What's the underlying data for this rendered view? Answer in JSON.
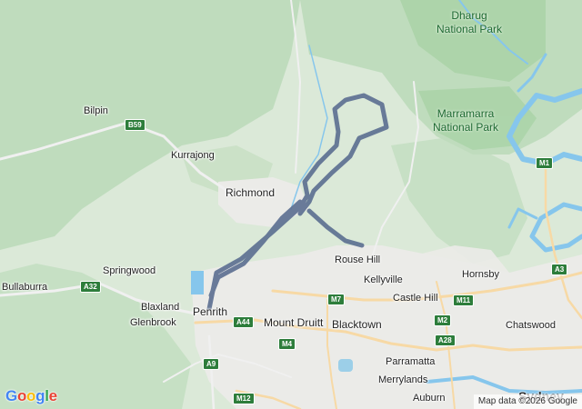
{
  "places": {
    "bilpin": "Bilpin",
    "kurrajong": "Kurrajong",
    "richmond": "Richmond",
    "springwood": "Springwood",
    "bullaburra": "Bullaburra",
    "blaxland": "Blaxland",
    "glenbrook": "Glenbrook",
    "penrith": "Penrith",
    "mount_druitt": "Mount Druitt",
    "blacktown": "Blacktown",
    "rouse_hill": "Rouse Hill",
    "kellyville": "Kellyville",
    "castle_hill": "Castle Hill",
    "hornsby": "Hornsby",
    "chatswood": "Chatswood",
    "parramatta": "Parramatta",
    "merrylands": "Merrylands",
    "auburn": "Auburn",
    "sydney_partial": "Sydney"
  },
  "parks": {
    "dharug": "Dharug\nNational Park",
    "marramarra": "Marramarra\nNational Park"
  },
  "road_shields": {
    "b59": "B59",
    "a32": "A32",
    "a44": "A44",
    "m7": "M7",
    "m4": "M4",
    "a9": "A9",
    "m12": "M12",
    "m11": "M11",
    "m2": "M2",
    "a28": "A28",
    "m1": "M1",
    "a3": "A3"
  },
  "attribution": {
    "logo": "Google",
    "text": "Map data ©2026 Google"
  },
  "colors": {
    "route": "#5b6e91",
    "water": "#86c6ec",
    "forest": "#bfdcbd",
    "urban": "#ececec",
    "shield": "#2d7d3b"
  }
}
